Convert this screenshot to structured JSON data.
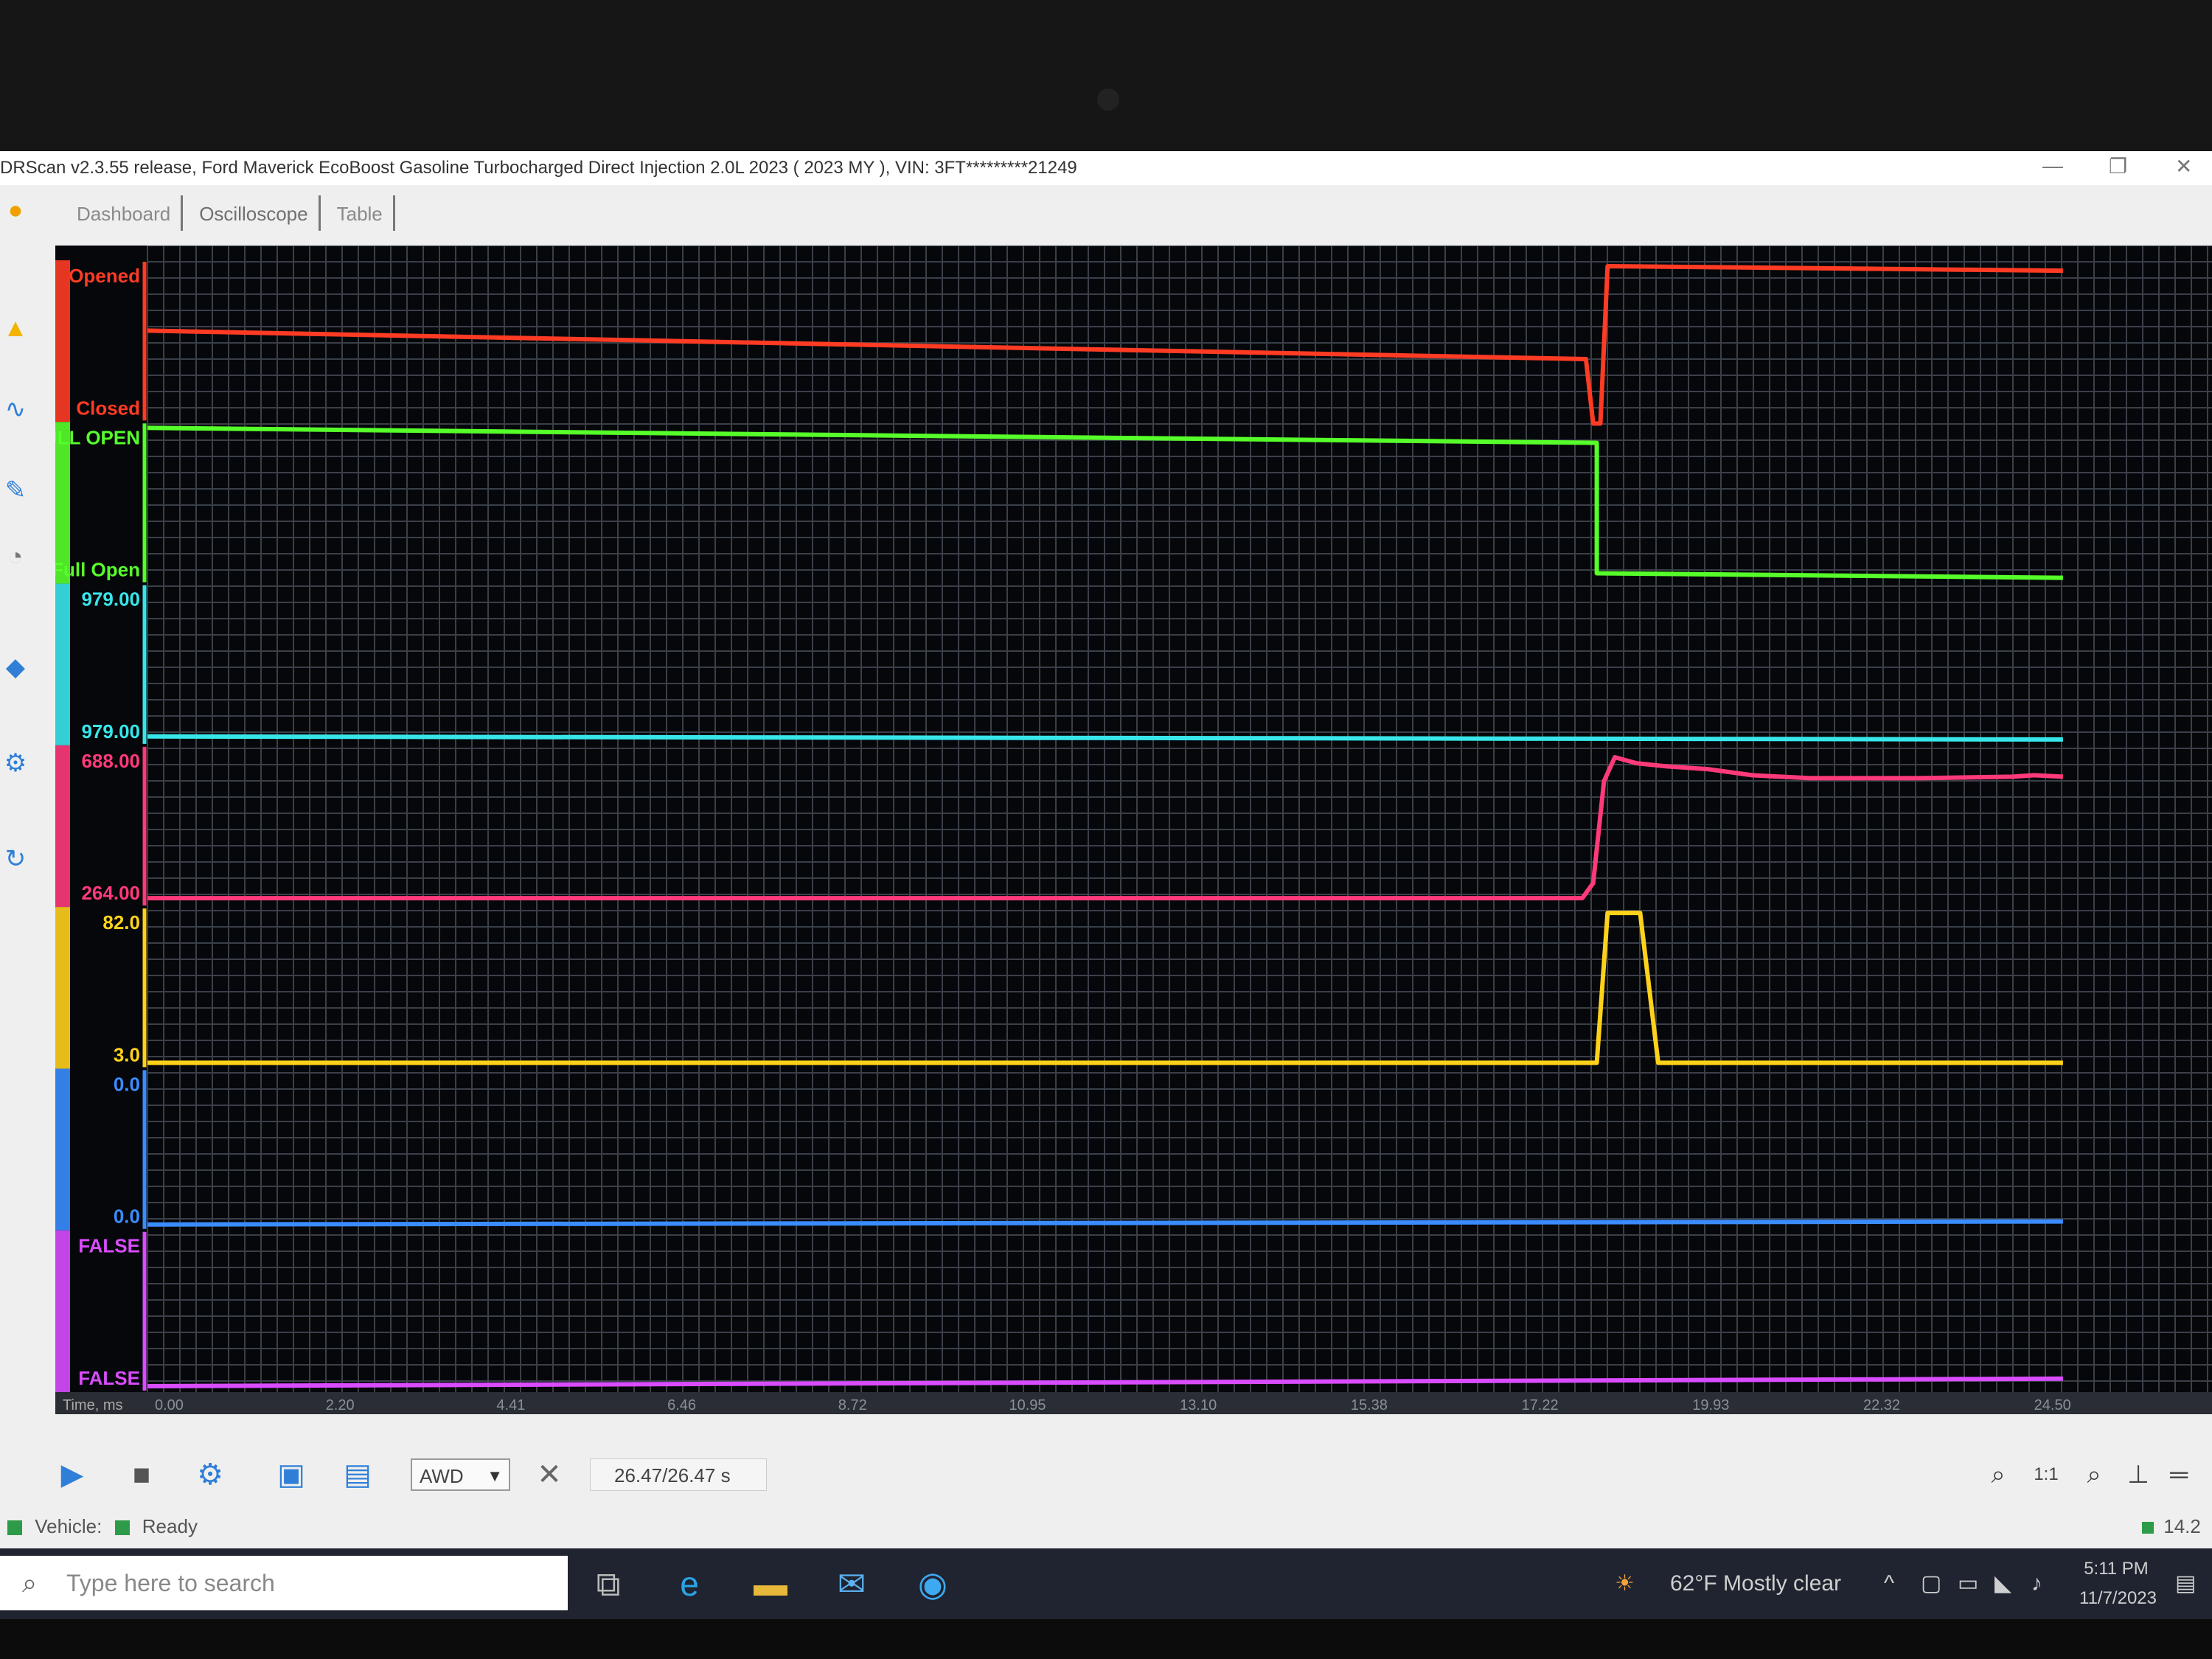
{
  "window": {
    "title": "DRScan v2.3.55 release, Ford Maverick EcoBoost Gasoline Turbocharged Direct Injection 2.0L 2023 ( 2023 MY ), VIN: 3FT*********21249",
    "controls": [
      "—",
      "❐",
      "✕"
    ]
  },
  "tabs": [
    {
      "label": "Dashboard"
    },
    {
      "label": "Oscilloscope"
    },
    {
      "label": "Table"
    }
  ],
  "colors": {
    "red": "#ff3b24",
    "green": "#57ff2a",
    "cyan": "#38e6ea",
    "pink": "#ff3a7a",
    "yellow": "#ffd21a",
    "blue": "#3a8cff",
    "magenta": "#d94cff",
    "grid": "#3a3f48",
    "background": "#05070a"
  },
  "chart_data": {
    "type": "line",
    "x_unit": "s",
    "x_label": "Time, ms",
    "x_ticks": [
      "0.00",
      "2.20",
      "4.41",
      "6.46",
      "8.72",
      "10.95",
      "13.10",
      "15.38",
      "17.22",
      "19.93",
      "22.32",
      "24.50"
    ],
    "xlim": [
      0,
      26.47
    ],
    "series": [
      {
        "color": "red",
        "range_labels": [
          "Opened",
          "Closed"
        ],
        "ylim": [
          0,
          1
        ],
        "points": [
          [
            0,
            0.57
          ],
          [
            19.9,
            0.38
          ],
          [
            20.0,
            -0.05
          ],
          [
            20.1,
            -0.05
          ],
          [
            20.2,
            1.0
          ],
          [
            26.5,
            0.97
          ]
        ]
      },
      {
        "color": "green",
        "range_labels": [
          "FULL OPEN",
          "Full Open"
        ],
        "ylim": [
          0,
          1
        ],
        "points": [
          [
            0,
            1.0
          ],
          [
            20.05,
            0.9
          ],
          [
            20.05,
            0.03
          ],
          [
            26.5,
            0.0
          ]
        ]
      },
      {
        "color": "cyan",
        "range_labels": [
          "979.00",
          "979.00"
        ],
        "ylim": [
          979,
          979
        ],
        "points": [
          [
            0,
            0.02
          ],
          [
            26.5,
            0.0
          ]
        ]
      },
      {
        "color": "pink",
        "range_labels": [
          "688.00",
          "264.00"
        ],
        "ylim": [
          264,
          688
        ],
        "points": [
          [
            0,
            0.02
          ],
          [
            19.85,
            0.02
          ],
          [
            20.0,
            0.12
          ],
          [
            20.15,
            0.8
          ],
          [
            20.3,
            0.96
          ],
          [
            20.6,
            0.92
          ],
          [
            21.0,
            0.9
          ],
          [
            21.6,
            0.88
          ],
          [
            22.2,
            0.84
          ],
          [
            23.0,
            0.82
          ],
          [
            24.5,
            0.82
          ],
          [
            25.8,
            0.83
          ],
          [
            26.1,
            0.84
          ],
          [
            26.5,
            0.83
          ]
        ]
      },
      {
        "color": "yellow",
        "range_labels": [
          "82.0",
          "3.0"
        ],
        "ylim": [
          3,
          82
        ],
        "points": [
          [
            0,
            0.0
          ],
          [
            20.05,
            0.0
          ],
          [
            20.2,
            1.0
          ],
          [
            20.65,
            1.0
          ],
          [
            20.9,
            0.0
          ],
          [
            26.5,
            0.0
          ]
        ]
      },
      {
        "color": "blue",
        "range_labels": [
          "0.0",
          "0.0"
        ],
        "ylim": [
          0,
          0
        ],
        "points": [
          [
            0,
            0.0
          ],
          [
            26.5,
            0.02
          ]
        ]
      },
      {
        "color": "magenta",
        "range_labels": [
          "FALSE",
          "FALSE"
        ],
        "ylim": [
          0,
          0
        ],
        "points": [
          [
            0,
            0.0
          ],
          [
            26.5,
            0.05
          ]
        ]
      }
    ]
  },
  "toolbar": {
    "drive_select": "AWD",
    "time_readout": "26.47/26.47 s",
    "zoom_ratio": "1:1"
  },
  "status": {
    "vehicle_label": "Vehicle:",
    "ready_label": "Ready",
    "voltage": "14.2"
  },
  "taskbar": {
    "search_placeholder": "Type here to search",
    "weather": "62°F  Mostly clear",
    "time": "5:11 PM",
    "date": "11/7/2023"
  }
}
